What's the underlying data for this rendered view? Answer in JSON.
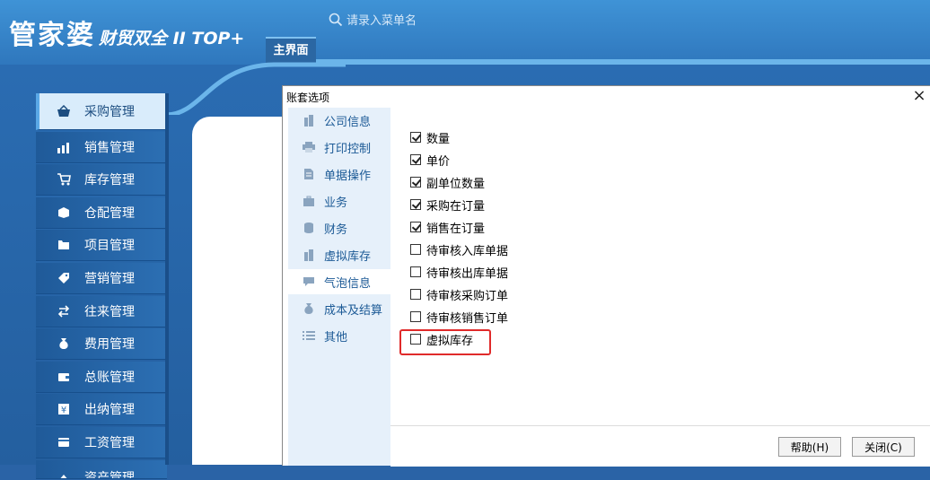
{
  "header": {
    "logo_main": "管家婆",
    "logo_sub": "财贸双全 II TOP+",
    "search_placeholder": "请录入菜单名",
    "main_tab": "主界面"
  },
  "sidebar": {
    "items": [
      {
        "label": "采购管理",
        "icon": "basket-icon"
      },
      {
        "label": "销售管理",
        "icon": "chart-icon"
      },
      {
        "label": "库存管理",
        "icon": "cart-icon"
      },
      {
        "label": "仓配管理",
        "icon": "box-icon"
      },
      {
        "label": "项目管理",
        "icon": "folder-icon"
      },
      {
        "label": "营销管理",
        "icon": "tag-icon"
      },
      {
        "label": "往来管理",
        "icon": "exchange-icon"
      },
      {
        "label": "费用管理",
        "icon": "money-bag-icon"
      },
      {
        "label": "总账管理",
        "icon": "wallet-icon"
      },
      {
        "label": "出纳管理",
        "icon": "cash-icon"
      },
      {
        "label": "工资管理",
        "icon": "card-icon"
      },
      {
        "label": "资产管理",
        "icon": "asset-icon"
      }
    ]
  },
  "dialog": {
    "title": "账套选项",
    "close_symbol": "×",
    "options": [
      {
        "label": "公司信息",
        "icon": "building-icon"
      },
      {
        "label": "打印控制",
        "icon": "printer-icon"
      },
      {
        "label": "单据操作",
        "icon": "document-icon"
      },
      {
        "label": "业务",
        "icon": "briefcase-icon"
      },
      {
        "label": "财务",
        "icon": "coins-icon"
      },
      {
        "label": "虚拟库存",
        "icon": "building-icon"
      },
      {
        "label": "气泡信息",
        "icon": "speech-bubble-icon"
      },
      {
        "label": "成本及结算",
        "icon": "money-bag-icon"
      },
      {
        "label": "其他",
        "icon": "list-icon"
      }
    ],
    "selected_option": "气泡信息",
    "checkboxes": [
      {
        "label": "数量",
        "checked": true
      },
      {
        "label": "单价",
        "checked": true
      },
      {
        "label": "副单位数量",
        "checked": true
      },
      {
        "label": "采购在订量",
        "checked": true
      },
      {
        "label": "销售在订量",
        "checked": true
      },
      {
        "label": "待审核入库单据",
        "checked": false
      },
      {
        "label": "待审核出库单据",
        "checked": false
      },
      {
        "label": "待审核采购订单",
        "checked": false
      },
      {
        "label": "待审核销售订单",
        "checked": false
      },
      {
        "label": "虚拟库存",
        "checked": false
      }
    ],
    "help_button": "帮助(H)",
    "close_button": "关闭(C)"
  },
  "colors": {
    "accent": "#2f77bd",
    "highlight": "#e02a2a"
  }
}
